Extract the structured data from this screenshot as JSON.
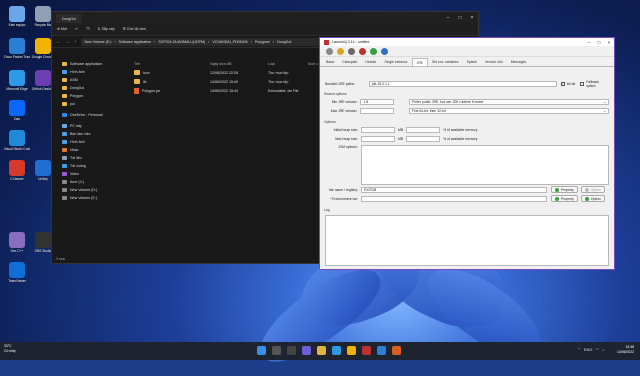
{
  "desktop": {
    "icons": [
      {
        "label": "Este equipo",
        "color": "#6aa7e8"
      },
      {
        "label": "Recycle Bin",
        "color": "#8fa0b4"
      },
      {
        "label": "Cisco Packet Tracer",
        "color": "#2b7fd3"
      },
      {
        "label": "Google Chrome",
        "color": "#f0b400"
      },
      {
        "label": "Microsoft Edge",
        "color": "#2c9ae8"
      },
      {
        "label": "GitHub Desktop",
        "color": "#6b3fb2"
      },
      {
        "label": "Zalo",
        "color": "#0a68ff"
      },
      {
        "label": "Visual Studio Code",
        "color": "#1f8ad8"
      },
      {
        "label": "CCleaner",
        "color": "#d33a2c"
      },
      {
        "label": "Unikey",
        "color": "#1e6fd0"
      },
      {
        "label": "Dev-C++",
        "color": "#8a6cc0"
      },
      {
        "label": "OBS Studio",
        "color": "#333"
      },
      {
        "label": "TeamViewer",
        "color": "#0e6fd6"
      }
    ]
  },
  "explorer": {
    "tab_title": "DongGoi",
    "cmd": {
      "new": "Mới",
      "sort": "Sắp xếp",
      "view": "Chế độ xem"
    },
    "path": [
      "New Volume (E:)",
      "Software application",
      "SOF304-DUANMAU-(UDPM)",
      "VOVANDAI_PD05406",
      "Polygone",
      "DongGoi"
    ],
    "sidebar": [
      "Software application",
      "Hình ảnh",
      "ASM",
      "DongGoi",
      "Polygon",
      "poi",
      "OneDrive - Personal",
      "PC này",
      "Bàn làm việc",
      "Hình ảnh",
      "Nhạc",
      "Tài liệu",
      "Tải xuống",
      "Video",
      "Acer (C:)",
      "New Volume (D:)",
      "New Volume (E:)"
    ],
    "headers": {
      "name": "Tên",
      "date": "Ngày sửa đổi",
      "type": "Loại",
      "size": "Kích c"
    },
    "files": [
      {
        "name": "icon",
        "date": "12/06/2022 22:28",
        "type": "Thư mục tệp",
        "kind": "folder"
      },
      {
        "name": "lib",
        "date": "14/06/2022 15:40",
        "type": "Thư mục tệp",
        "kind": "folder"
      },
      {
        "name": "Polygon.jar",
        "date": "14/06/2022 15:44",
        "type": "Executable Jar File",
        "kind": "jar"
      }
    ],
    "status": "3 mục"
  },
  "launch4j": {
    "title": "Launch4j 3.14 - untitled",
    "tabs": [
      "Basic",
      "Classpath",
      "Header",
      "Single instance",
      "JRE",
      "Set env. variables",
      "Splash",
      "Version info",
      "Messages"
    ],
    "active_tab": "JRE",
    "bundled_label": "Bundled JRE paths:",
    "bundled_value": "jdk-18.0.1.1",
    "is64_label": "64-bit",
    "fallback_label": "Fallback option",
    "search_options": "Search options",
    "min_label": "Min JRE version:",
    "min_value": "1.8",
    "max_label": "Max JRE version:",
    "pref1": "Prefer public JRE, but use JDK runtime if newer",
    "pref2": "First 64-bit, then 32-bit",
    "options_label": "Options",
    "initial_heap": "Initial heap size:",
    "max_heap": "Max heap size:",
    "mb": "MB",
    "available_mem": "% of available memory",
    "jvm_options": "JVM options:",
    "varreg_label": "Var name / registry:",
    "varreg_value": "EXITDB",
    "property_label": "Property",
    "option_label": "Option",
    "env_label": "* Environment var:",
    "log_label": "Log"
  },
  "taskbar": {
    "weather_temp": "33°C",
    "weather_desc": "Có mây",
    "time": "15:48",
    "date": "14/06/2022",
    "lang": "ENG"
  }
}
